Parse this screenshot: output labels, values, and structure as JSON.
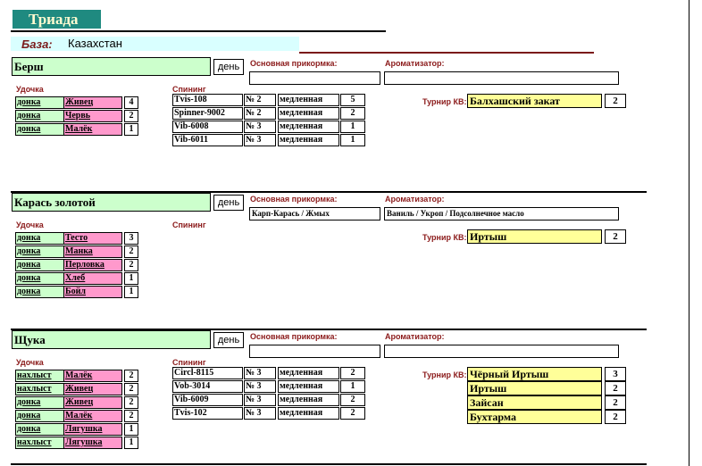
{
  "app": {
    "title": "Триада"
  },
  "base": {
    "label": "База:",
    "value": "Казахстан"
  },
  "labels": {
    "day": "день",
    "main_bait": "Основная прикормка:",
    "flavor": "Ароматизатор:",
    "rod": "Удочка",
    "spinning": "Спининг",
    "tournament": "Турнир КВ:"
  },
  "sections": [
    {
      "fish": "Берш",
      "main_bait": "",
      "flavor": "",
      "rods": [
        {
          "type": "донка",
          "bait": "Живец",
          "count": "4"
        },
        {
          "type": "донка",
          "bait": "Червь",
          "count": "2"
        },
        {
          "type": "донка",
          "bait": "Малёк",
          "count": "1"
        }
      ],
      "spinning": [
        {
          "model": "Tvis-108",
          "no": "№ 2",
          "speed": "медленная",
          "count": "5"
        },
        {
          "model": "Spinner-9002",
          "no": "№ 2",
          "speed": "медленная",
          "count": "2"
        },
        {
          "model": "Vib-6008",
          "no": "№ 3",
          "speed": "медленная",
          "count": "1"
        },
        {
          "model": "Vib-6011",
          "no": "№ 3",
          "speed": "медленная",
          "count": "1"
        }
      ],
      "tournaments": [
        {
          "name": "Балхашский закат",
          "count": "2"
        }
      ]
    },
    {
      "fish": "Карась золотой",
      "main_bait": "Карп-Карась / Жмых",
      "flavor": "Ваниль / Укроп / Подсолнечное масло",
      "rods": [
        {
          "type": "донка",
          "bait": "Тесто",
          "count": "3"
        },
        {
          "type": "донка",
          "bait": "Манка",
          "count": "2"
        },
        {
          "type": "донка",
          "bait": "Перловка",
          "count": "2"
        },
        {
          "type": "донка",
          "bait": "Хлеб",
          "count": "1"
        },
        {
          "type": "донка",
          "bait": "Бойл",
          "count": "1"
        }
      ],
      "spinning": [],
      "tournaments": [
        {
          "name": "Иртыш",
          "count": "2"
        }
      ]
    },
    {
      "fish": "Щука",
      "main_bait": "",
      "flavor": "",
      "rods": [
        {
          "type": "нахлыст",
          "bait": "Малёк",
          "count": "2"
        },
        {
          "type": "нахлыст",
          "bait": "Живец",
          "count": "2"
        },
        {
          "type": "донка",
          "bait": "Живец",
          "count": "2"
        },
        {
          "type": "донка",
          "bait": "Малёк",
          "count": "2"
        },
        {
          "type": "донка",
          "bait": "Лягушка",
          "count": "1"
        },
        {
          "type": "нахлыст",
          "bait": "Лягушка",
          "count": "1"
        }
      ],
      "spinning": [
        {
          "model": "Circl-8115",
          "no": "№ 3",
          "speed": "медленная",
          "count": "2"
        },
        {
          "model": "Vob-3014",
          "no": "№ 3",
          "speed": "медленная",
          "count": "1"
        },
        {
          "model": "Vib-6009",
          "no": "№ 3",
          "speed": "медленная",
          "count": "2"
        },
        {
          "model": "Tvis-102",
          "no": "№ 3",
          "speed": "медленная",
          "count": "2"
        }
      ],
      "tournaments": [
        {
          "name": "Чёрный Иртыш",
          "count": "3"
        },
        {
          "name": "Иртыш",
          "count": "2"
        },
        {
          "name": "Зайсан",
          "count": "2"
        },
        {
          "name": "Бухтарма",
          "count": "2"
        }
      ]
    }
  ]
}
